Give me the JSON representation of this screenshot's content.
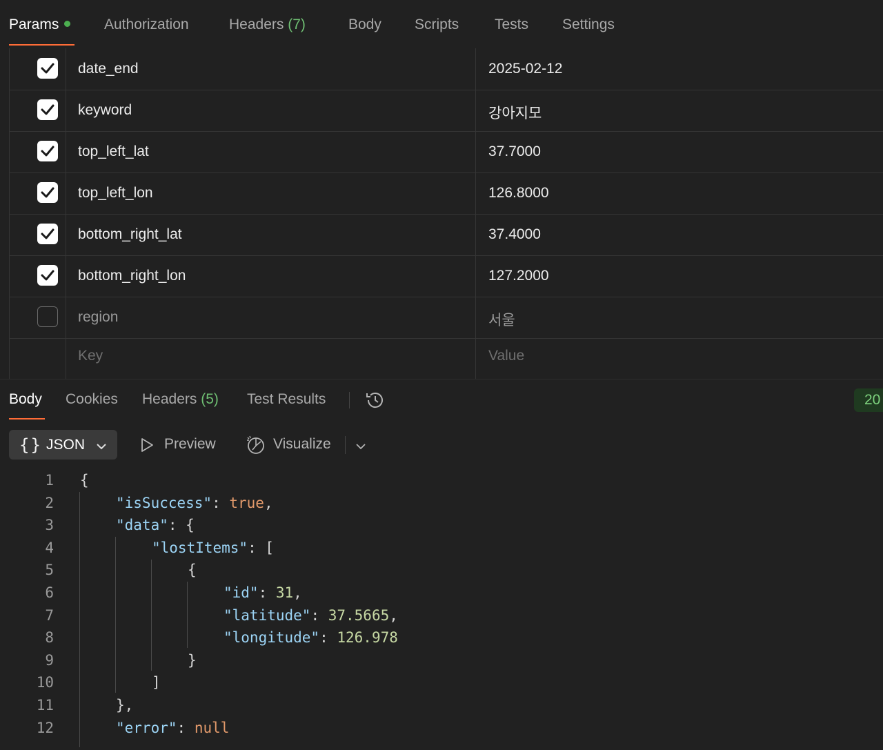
{
  "request_tabs": {
    "params": "Params",
    "authorization": "Authorization",
    "headers_label": "Headers",
    "headers_count": "(7)",
    "body": "Body",
    "scripts": "Scripts",
    "tests": "Tests",
    "settings": "Settings"
  },
  "params": [
    {
      "checked": true,
      "key": "date_end",
      "value": "2025-02-12"
    },
    {
      "checked": true,
      "key": "keyword",
      "value": "강아지모"
    },
    {
      "checked": true,
      "key": "top_left_lat",
      "value": "37.7000"
    },
    {
      "checked": true,
      "key": "top_left_lon",
      "value": "126.8000"
    },
    {
      "checked": true,
      "key": "bottom_right_lat",
      "value": "37.4000"
    },
    {
      "checked": true,
      "key": "bottom_right_lon",
      "value": "127.2000"
    },
    {
      "checked": false,
      "key": "region",
      "value": "서울"
    }
  ],
  "params_placeholder": {
    "key": "Key",
    "value": "Value"
  },
  "response_tabs": {
    "body": "Body",
    "cookies": "Cookies",
    "headers_label": "Headers",
    "headers_count": "(5)",
    "test_results": "Test Results",
    "history_icon": "history-icon"
  },
  "status_code_visible": "20",
  "format": {
    "selected": "JSON",
    "preview": "Preview",
    "visualize": "Visualize"
  },
  "code_lines": [
    {
      "n": "1",
      "text": "{"
    },
    {
      "n": "2",
      "text": "\"isSuccess\": true,"
    },
    {
      "n": "3",
      "text": "\"data\": {"
    },
    {
      "n": "4",
      "text": "\"lostItems\": ["
    },
    {
      "n": "5",
      "text": "{"
    },
    {
      "n": "6",
      "text": "\"id\": 31,"
    },
    {
      "n": "7",
      "text": "\"latitude\": 37.5665,"
    },
    {
      "n": "8",
      "text": "\"longitude\": 126.978"
    },
    {
      "n": "9",
      "text": "}"
    },
    {
      "n": "10",
      "text": "]"
    },
    {
      "n": "11",
      "text": "},"
    },
    {
      "n": "12",
      "text": "\"error\": null"
    }
  ],
  "colors": {
    "background": "#212121",
    "accent_underline": "#ff6c37",
    "dot_green": "#4caf50",
    "json_key": "#9cd4f5",
    "json_boolean": "#e39a6b",
    "json_number": "#c7d9a4"
  }
}
